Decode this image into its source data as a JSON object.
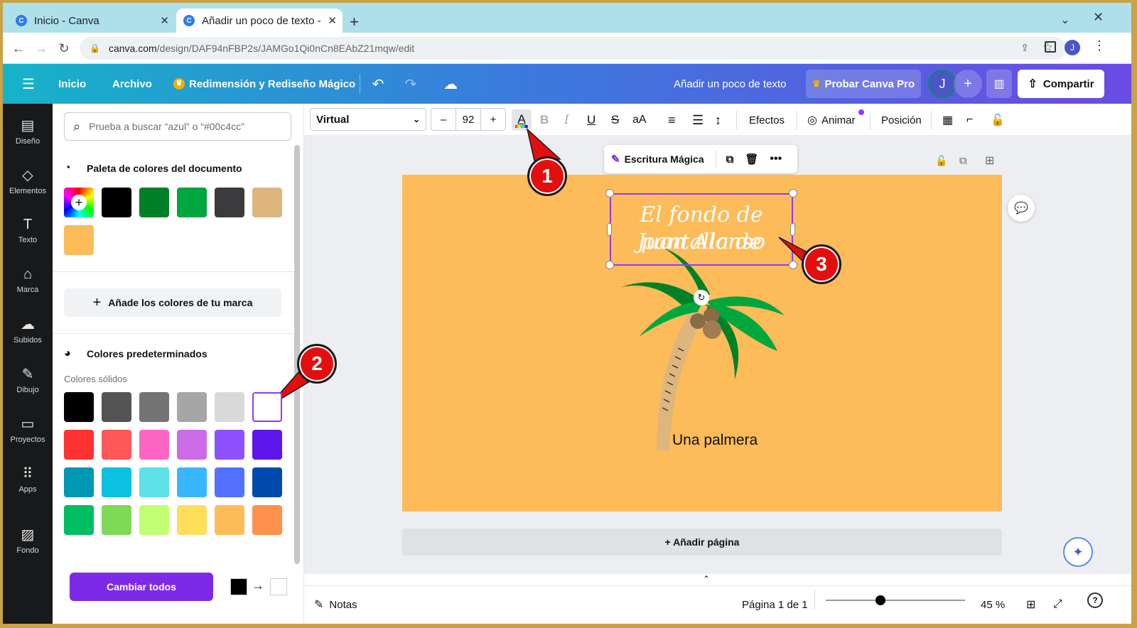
{
  "browser": {
    "tabs": [
      {
        "title": "Inicio - Canva"
      },
      {
        "title": "Añadir un poco de texto -"
      }
    ],
    "url_domain": "canva.com",
    "url_path": "/design/DAF94nFBP2s/JAMGo1Qi0nCn8EAbZ21mqw/edit",
    "profile_initial": "J"
  },
  "header": {
    "home": "Inicio",
    "file": "Archivo",
    "magic": "Redimensión y Rediseño Mágico",
    "doc_title": "Añadir un poco de texto",
    "pro": "Probar Canva Pro",
    "avatar": "J",
    "share": "Compartir"
  },
  "rail": [
    {
      "label": "Diseño",
      "icon": "layout-icon"
    },
    {
      "label": "Elementos",
      "icon": "shapes-icon"
    },
    {
      "label": "Texto",
      "icon": "text-icon"
    },
    {
      "label": "Marca",
      "icon": "brand-icon"
    },
    {
      "label": "Subidos",
      "icon": "upload-icon"
    },
    {
      "label": "Dibujo",
      "icon": "draw-icon"
    },
    {
      "label": "Proyectos",
      "icon": "folder-icon"
    },
    {
      "label": "Apps",
      "icon": "apps-icon"
    },
    {
      "label": "Fondo",
      "icon": "background-icon"
    }
  ],
  "panel": {
    "search_placeholder": "Prueba a buscar “azul” o “#00c4cc”",
    "doc_palette_title": "Paleta de colores del documento",
    "doc_colors": [
      "#000000",
      "#008127",
      "#00a63e",
      "#3b3a3c",
      "#ddb67e",
      "#fdbb5a"
    ],
    "brand_button": "Añade los colores de tu marca",
    "default_title": "Colores predeterminados",
    "solid_label": "Colores sólidos",
    "solid_colors": [
      "#000000",
      "#545454",
      "#737373",
      "#a6a6a6",
      "#d9d9d9",
      "#ffffff",
      "#ff3131",
      "#ff5757",
      "#ff66c4",
      "#cb6ce6",
      "#8c52ff",
      "#5e17eb",
      "#0097b2",
      "#0cc0df",
      "#5ce1e6",
      "#38b6ff",
      "#5271ff",
      "#004aad",
      "#00bf63",
      "#7ed957",
      "#c1ff72",
      "#ffde59",
      "#ffbd59",
      "#ff914d"
    ],
    "change_all": "Cambiar todos"
  },
  "toolbar": {
    "font": "Virtual",
    "size": "92",
    "effects": "Efectos",
    "animate": "Animar",
    "position": "Posición"
  },
  "canvas": {
    "magic_write": "Escritura Mágica",
    "heading_line1": "El fondo de pantalla de",
    "heading_line2": "Juan Alonso",
    "caption": "Una palmera",
    "add_page": "+ Añadir página"
  },
  "footer": {
    "notes": "Notas",
    "page": "Página 1 de 1",
    "zoom": "45 %",
    "zoom_level": 0.45
  },
  "annotations": [
    "1",
    "2",
    "3"
  ],
  "colors": {
    "accent": "#7d2ae8",
    "canvas_bg": "#fdbb5a",
    "badge": "#e30f0f"
  }
}
